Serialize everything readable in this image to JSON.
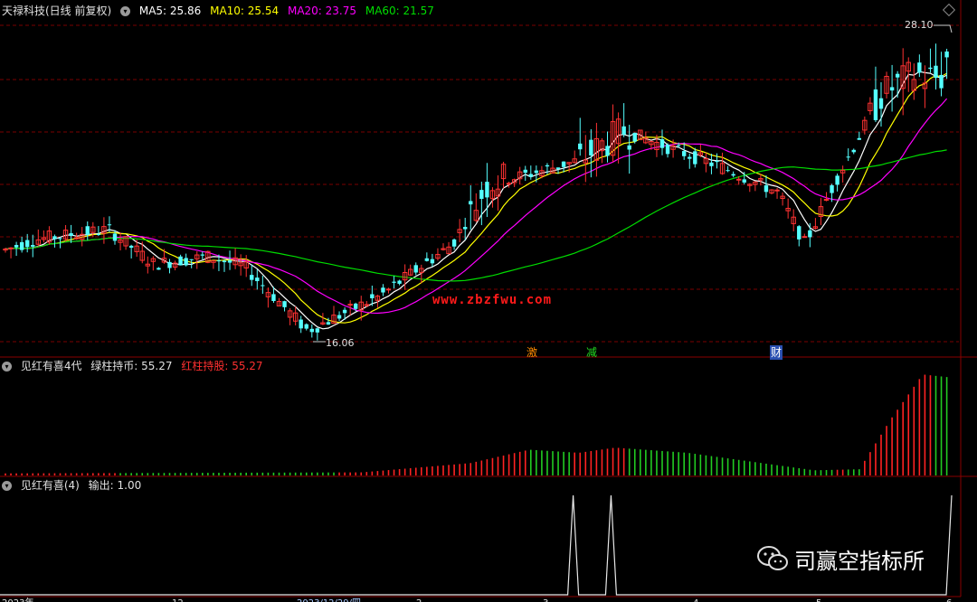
{
  "header_main": {
    "stock": "天禄科技(日线 前复权)",
    "ma5": "MA5: 25.86",
    "ma10": "MA10: 25.54",
    "ma20": "MA20: 23.75",
    "ma60": "MA60: 21.57",
    "colors": {
      "stock": "#e0e0e0",
      "ma5": "#ffffff",
      "ma10": "#ffff00",
      "ma20": "#ff00ff",
      "ma60": "#00dd00"
    }
  },
  "header_ind1": {
    "name": "见红有喜4代",
    "green": "绿柱持币: 55.27",
    "red": "红柱持股: 55.27"
  },
  "header_ind2": {
    "name": "见红有喜(4)",
    "output": "输出: 1.00"
  },
  "labels": {
    "high": "28.10",
    "low": "16.06",
    "site": "www.zbzfwu.com",
    "badge1": "激",
    "badge2": "减",
    "badge3": "财"
  },
  "watermark": {
    "text": "司赢空指标所",
    "icon": "wechat-icon"
  },
  "axis_labels": [
    "2023年",
    "12",
    "2023/12/29/四",
    "2",
    "3",
    "4",
    "5",
    "6"
  ],
  "chart_data": {
    "type": "candlestick",
    "price_range": [
      15.5,
      28.5
    ],
    "high_label": 28.1,
    "low_label": 16.06,
    "ma_lines": [
      {
        "name": "MA5",
        "value": 25.86,
        "color": "#ffffff"
      },
      {
        "name": "MA10",
        "value": 25.54,
        "color": "#ffff00"
      },
      {
        "name": "MA20",
        "value": 23.75,
        "color": "#ff00ff"
      },
      {
        "name": "MA60",
        "value": 21.57,
        "color": "#00dd00"
      }
    ],
    "indicator1": {
      "name": "见红有喜4代",
      "last": 55.27
    },
    "indicator2": {
      "name": "见红有喜(4)",
      "last": 1.0,
      "spikes_at_fraction": [
        0.6,
        0.64,
        1.0
      ]
    }
  }
}
